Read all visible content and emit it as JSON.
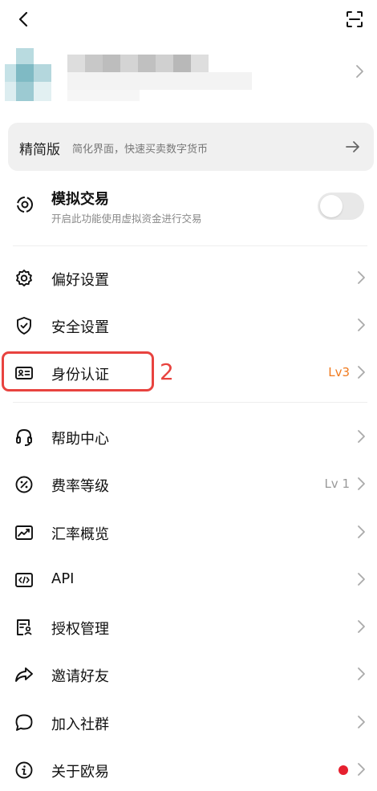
{
  "header": {
    "back_icon": "chevron-left-icon",
    "scan_icon": "scan-icon"
  },
  "simple_mode": {
    "title": "精简版",
    "description": "简化界面，快速买卖数字货币"
  },
  "demo_trading": {
    "title": "模拟交易",
    "subtitle": "开启此功能使用虚拟资金进行交易",
    "enabled": false
  },
  "menu": [
    {
      "label": "偏好设置",
      "icon": "gear-icon",
      "right": ""
    },
    {
      "label": "安全设置",
      "icon": "shield-icon",
      "right": ""
    },
    {
      "label": "身份认证",
      "icon": "id-card-icon",
      "right": "Lv3"
    },
    {
      "label": "帮助中心",
      "icon": "headset-icon",
      "right": ""
    },
    {
      "label": "费率等级",
      "icon": "percent-icon",
      "right": "Lv 1"
    },
    {
      "label": "汇率概览",
      "icon": "trend-chart-icon",
      "right": ""
    },
    {
      "label": "API",
      "icon": "code-icon",
      "right": ""
    },
    {
      "label": "授权管理",
      "icon": "document-user-icon",
      "right": ""
    },
    {
      "label": "邀请好友",
      "icon": "share-arrow-icon",
      "right": ""
    },
    {
      "label": "加入社群",
      "icon": "chat-bubble-icon",
      "right": ""
    },
    {
      "label": "关于欧易",
      "icon": "info-icon",
      "right": ""
    }
  ],
  "annotation": {
    "number": "2"
  },
  "colors": {
    "accent_orange": "#f07a1e",
    "annotation_red": "#e8433f",
    "badge_red": "#e6202f"
  }
}
